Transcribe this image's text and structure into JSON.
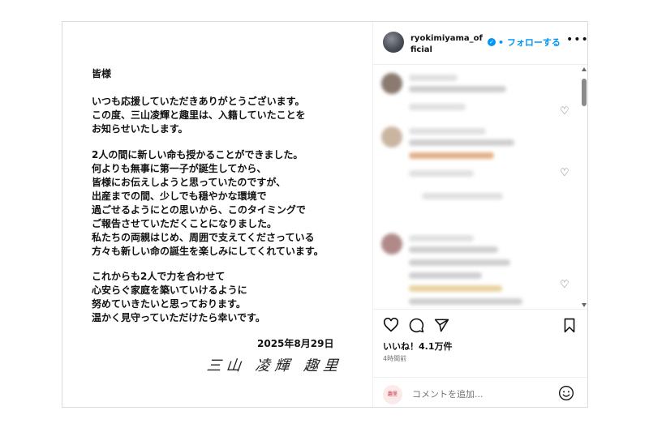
{
  "letter": {
    "lines": [
      "皆様",
      "いつも応援していただきありがとうございます。",
      "この度、三山凌輝と趣里は、入籍していたことを",
      "お知らせいたします。",
      "2人の間に新しい命も授かることができました。",
      "何よりも無事に第一子が誕生してから、",
      "皆様にお伝えしようと思っていたのですが、",
      "出産までの間、少しでも穏やかな環境で",
      "過ごせるようにとの思いから、このタイミングで",
      "ご報告させていただくことになりました。",
      "私たちの両親はじめ、周囲で支えてくださっている",
      "方々も新しい命の誕生を楽しみにしてくれています。",
      "これからも2人で力を合わせて",
      "心安らぐ家庭を築いていけるように",
      "努めていきたいと思っております。",
      "温かく見守っていただけたら幸いです。"
    ],
    "date": "2025年8月29日",
    "signature": "三山 凌輝 趣里"
  },
  "post": {
    "username": "ryokimiyama_official",
    "verified_icon": "verified-badge-icon",
    "follow_label": "• フォローする",
    "more_icon": "more-options-icon",
    "likes": "いいね！4.1万件",
    "time": "4時間前",
    "comment_placeholder": "コメントを追加...",
    "commenter_avatar_text": "趣里"
  },
  "colors": {
    "accent": "#0095f6",
    "muted": "#737373",
    "border": "#dbdbdb"
  }
}
